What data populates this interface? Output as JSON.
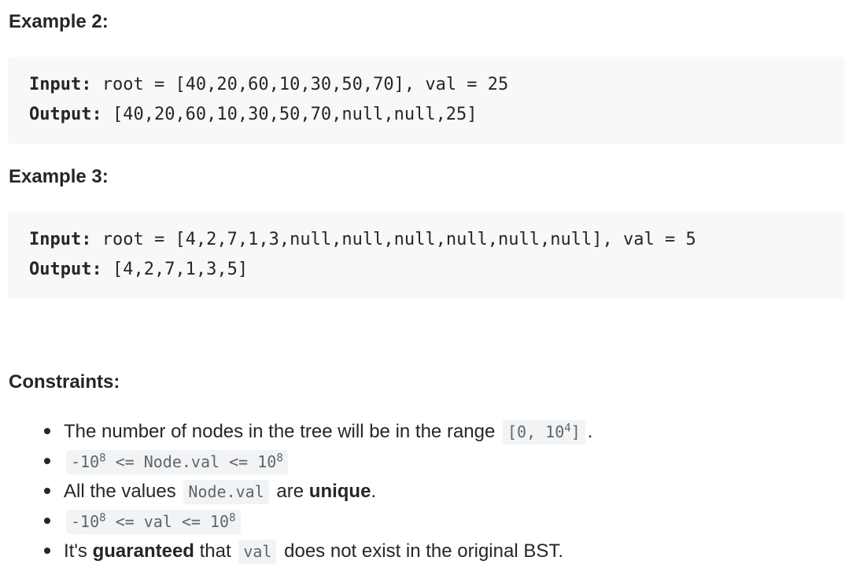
{
  "example2": {
    "heading": "Example 2:",
    "input_label": "Input:",
    "input_value": " root = [40,20,60,10,30,50,70], val = 25",
    "output_label": "Output:",
    "output_value": " [40,20,60,10,30,50,70,null,null,25]"
  },
  "example3": {
    "heading": "Example 3:",
    "input_label": "Input:",
    "input_value": " root = [4,2,7,1,3,null,null,null,null,null,null], val = 5",
    "output_label": "Output:",
    "output_value": " [4,2,7,1,3,5]"
  },
  "constraints": {
    "heading": "Constraints:",
    "item1": {
      "text": "The number of nodes in the tree will be in the range",
      "code_pre": "[0, 10",
      "code_sup": "4",
      "code_post": "]",
      "trail": "."
    },
    "item2": {
      "code_pre": "-10",
      "code_sup1": "8",
      "code_mid": " <= Node.val <= 10",
      "code_sup2": "8"
    },
    "item3": {
      "text_pre": "All the values",
      "code": "Node.val",
      "text_mid": "are",
      "strong": "unique",
      "trail": "."
    },
    "item4": {
      "code_pre": "-10",
      "code_sup1": "8",
      "code_mid": " <= val <= 10",
      "code_sup2": "8"
    },
    "item5": {
      "text_pre": "It's",
      "strong": "guaranteed",
      "text_mid": "that",
      "code": "val",
      "text_post": "does not exist in the original BST."
    }
  }
}
